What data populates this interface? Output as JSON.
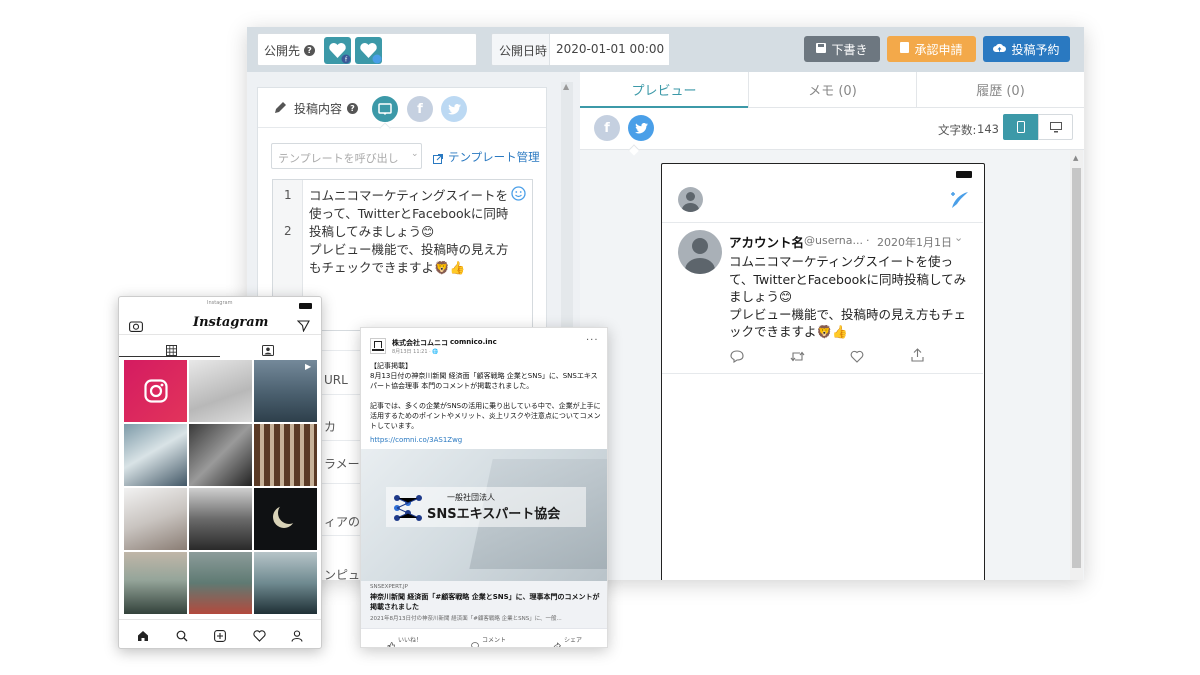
{
  "topbar": {
    "publish_to_label": "公開先",
    "publish_date_label": "公開日時",
    "publish_date_value": "2020-01-01 00:00",
    "draft_label": "下書き",
    "approval_label": "承認申請",
    "schedule_label": "投稿予約"
  },
  "editor": {
    "post_content_label": "投稿内容",
    "template_placeholder": "テンプレートを呼び出し",
    "template_manage_label": "テンプレート管理",
    "line_numbers": [
      "1",
      "2"
    ],
    "body_text": "コムニコマーケティングスイートを使って、TwitterとFacebookに同時投稿してみましょう😊\nプレビュー機能で、投稿時の見え方もチェックできますよ🦁👍",
    "hidden_rows": [
      "URL",
      "カ",
      "ラメー",
      "ィアの挿",
      "ンピュー"
    ]
  },
  "preview": {
    "tabs": [
      "プレビュー",
      "メモ (0)",
      "履歴 (0)"
    ],
    "char_count_label": "文字数:",
    "char_count_value": "143"
  },
  "tweet": {
    "account_name": "アカウント名",
    "username": "@userna...",
    "separator": "·",
    "date": "2020年1月1日",
    "text": "コムニコマーケティングスイートを使って、TwitterとFacebookに同時投稿してみましょう😊\nプレビュー機能で、投稿時の見え方もチェックできますよ🦁👍"
  },
  "instagram": {
    "status_title": "Instagram",
    "logo": "Instagram"
  },
  "facebook": {
    "page_name": "株式会社コムニコ",
    "page_handle": "comnico.inc",
    "post_meta": "8月13日 11:21 · 🌐",
    "post_text": "【記事掲載】\n8月13日付の神奈川新聞 経済面「顧客戦略 企業とSNS」に、SNSエキスパート協会理事 本門のコメントが掲載されました。\n\n記事では、多くの企業がSNSの活用に乗り出している中で、企業が上手に活用するためのポイントやメリット、炎上リスクや注意点についてコメントしています。",
    "link": "https://comni.co/3AS1Zwg",
    "banner_small": "一般社団法人",
    "banner_big": "SNSエキスパート協会",
    "link_domain": "SNSEXPERT.JP",
    "link_title": "神奈川新聞 経済面「#顧客戦略 企業とSNS」に、理事本門のコメントが掲載されました",
    "link_desc": "2021年8月13日付の神奈川新聞 経済面「#顧客戦略 企業とSNS」に、一般...",
    "like_label": "いいね！",
    "comment_label": "コメント",
    "share_label": "シェア"
  },
  "colors": {
    "draft": "#6d7780",
    "approval": "#f3a94a",
    "schedule": "#2a79c1",
    "teal": "#3c99a8",
    "twitter": "#4a9fe8",
    "facebook": "#a8b4c8"
  }
}
